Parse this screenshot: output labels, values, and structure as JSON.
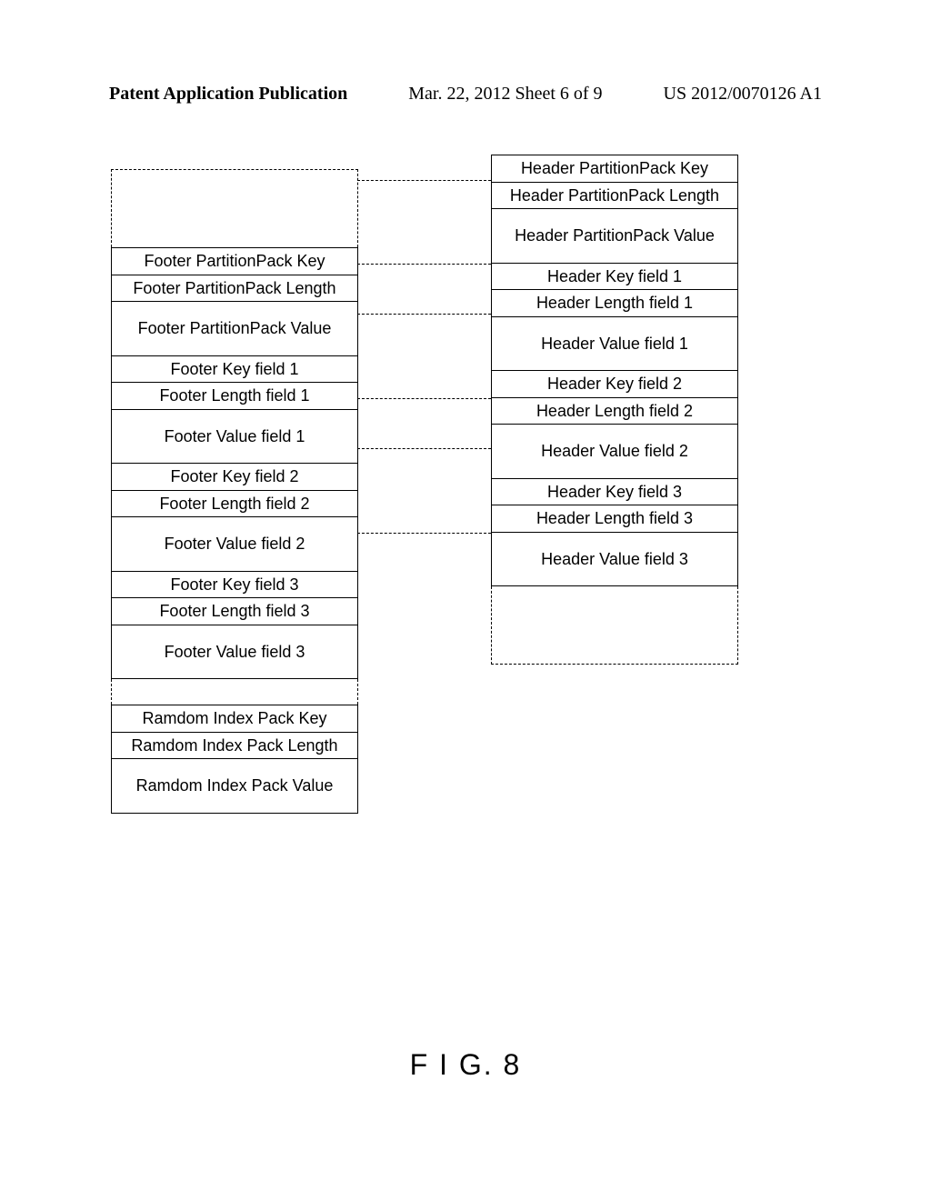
{
  "header": {
    "left": "Patent Application Publication",
    "center": "Mar. 22, 2012  Sheet 6 of 9",
    "right": "US 2012/0070126 A1"
  },
  "footer_box": {
    "rows": [
      {
        "text": "Footer PartitionPack Key",
        "cls": "cell"
      },
      {
        "text": "Footer PartitionPack Length",
        "cls": "cell"
      },
      {
        "text": "Footer PartitionPack Value",
        "cls": "cell value"
      },
      {
        "text": "Footer Key field 1",
        "cls": "cell"
      },
      {
        "text": "Footer Length field 1",
        "cls": "cell"
      },
      {
        "text": "Footer Value field 1",
        "cls": "cell value"
      },
      {
        "text": "Footer Key field 2",
        "cls": "cell"
      },
      {
        "text": "Footer Length field 2",
        "cls": "cell"
      },
      {
        "text": "Footer Value field 2",
        "cls": "cell value"
      },
      {
        "text": "Footer Key field 3",
        "cls": "cell"
      },
      {
        "text": "Footer Length field 3",
        "cls": "cell"
      },
      {
        "text": "Footer Value field 3",
        "cls": "cell value"
      }
    ]
  },
  "rip_box": {
    "rows": [
      {
        "text": "Ramdom Index Pack Key",
        "cls": "cell"
      },
      {
        "text": "Ramdom Index Pack Length",
        "cls": "cell"
      },
      {
        "text": "Ramdom Index Pack Value",
        "cls": "cell value"
      }
    ]
  },
  "header_box": {
    "rows": [
      {
        "text": "Header PartitionPack Key",
        "cls": "cell"
      },
      {
        "text": "Header PartitionPack Length",
        "cls": "cell"
      },
      {
        "text": "Header PartitionPack Value",
        "cls": "cell value"
      },
      {
        "text": "Header Key field 1",
        "cls": "cell"
      },
      {
        "text": "Header Length field 1",
        "cls": "cell"
      },
      {
        "text": "Header Value field 1",
        "cls": "cell value"
      },
      {
        "text": "Header Key field 2",
        "cls": "cell"
      },
      {
        "text": "Header Length field 2",
        "cls": "cell"
      },
      {
        "text": "Header Value field 2",
        "cls": "cell value"
      },
      {
        "text": "Header Key field 3",
        "cls": "cell"
      },
      {
        "text": "Header Length field 3",
        "cls": "cell"
      },
      {
        "text": "Header Value field 3",
        "cls": "cell value"
      }
    ]
  },
  "figure_label": "F I G. 8"
}
